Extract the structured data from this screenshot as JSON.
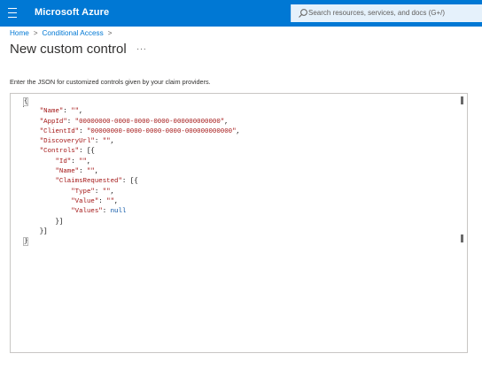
{
  "header": {
    "brand": "Microsoft Azure",
    "search_placeholder": "Search resources, services, and docs (G+/)"
  },
  "breadcrumb": {
    "items": [
      "Home",
      "Conditional Access"
    ]
  },
  "page": {
    "title": "New custom control",
    "more": "···",
    "instructions": "Enter the JSON for customized controls given by your claim providers."
  },
  "editor": {
    "lines": [
      "{",
      "    \"Name\": \"\",",
      "    \"AppId\": \"00000000-0000-0000-0000-000000000000\",",
      "    \"ClientId\": \"00000000-0000-0000-0000-000000000000\",",
      "    \"DiscoveryUrl\": \"\",",
      "    \"Controls\": [{",
      "        \"Id\": \"\",",
      "        \"Name\": \"\",",
      "        \"ClaimsRequested\": [{",
      "            \"Type\": \"\",",
      "            \"Value\": \"\",",
      "            \"Values\": null",
      "        }]",
      "    }]",
      "}"
    ]
  }
}
